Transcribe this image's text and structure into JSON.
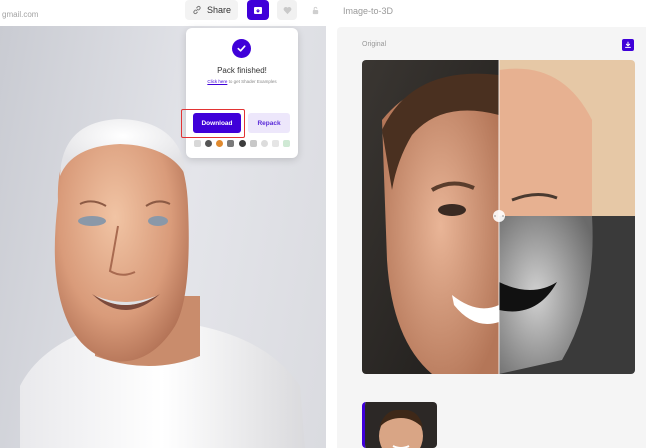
{
  "header": {
    "email_fragment": "gmail.com",
    "share_label": "Share",
    "share_icon": "link-icon",
    "pack_icon": "package-icon",
    "heart_icon": "heart-icon",
    "lock_icon": "lock-icon",
    "accent_color": "#3f00d9"
  },
  "popup": {
    "status_icon": "check-circle-icon",
    "message": "Pack finished!",
    "link_text": "Click here",
    "sub_text": " to get Shader Examples",
    "download_label": "Download",
    "repack_label": "Repack",
    "highlight_color": "#e23333",
    "engine_icons": [
      "blender-icon",
      "unity-icon",
      "unreal-icon",
      "maya-icon",
      "3dsmax-icon",
      "c4d-icon",
      "houdini-icon",
      "godot-icon",
      "ar-icon"
    ]
  },
  "panel": {
    "title": "Image-to-3D",
    "original_label": "Original",
    "download_icon": "download-icon"
  }
}
